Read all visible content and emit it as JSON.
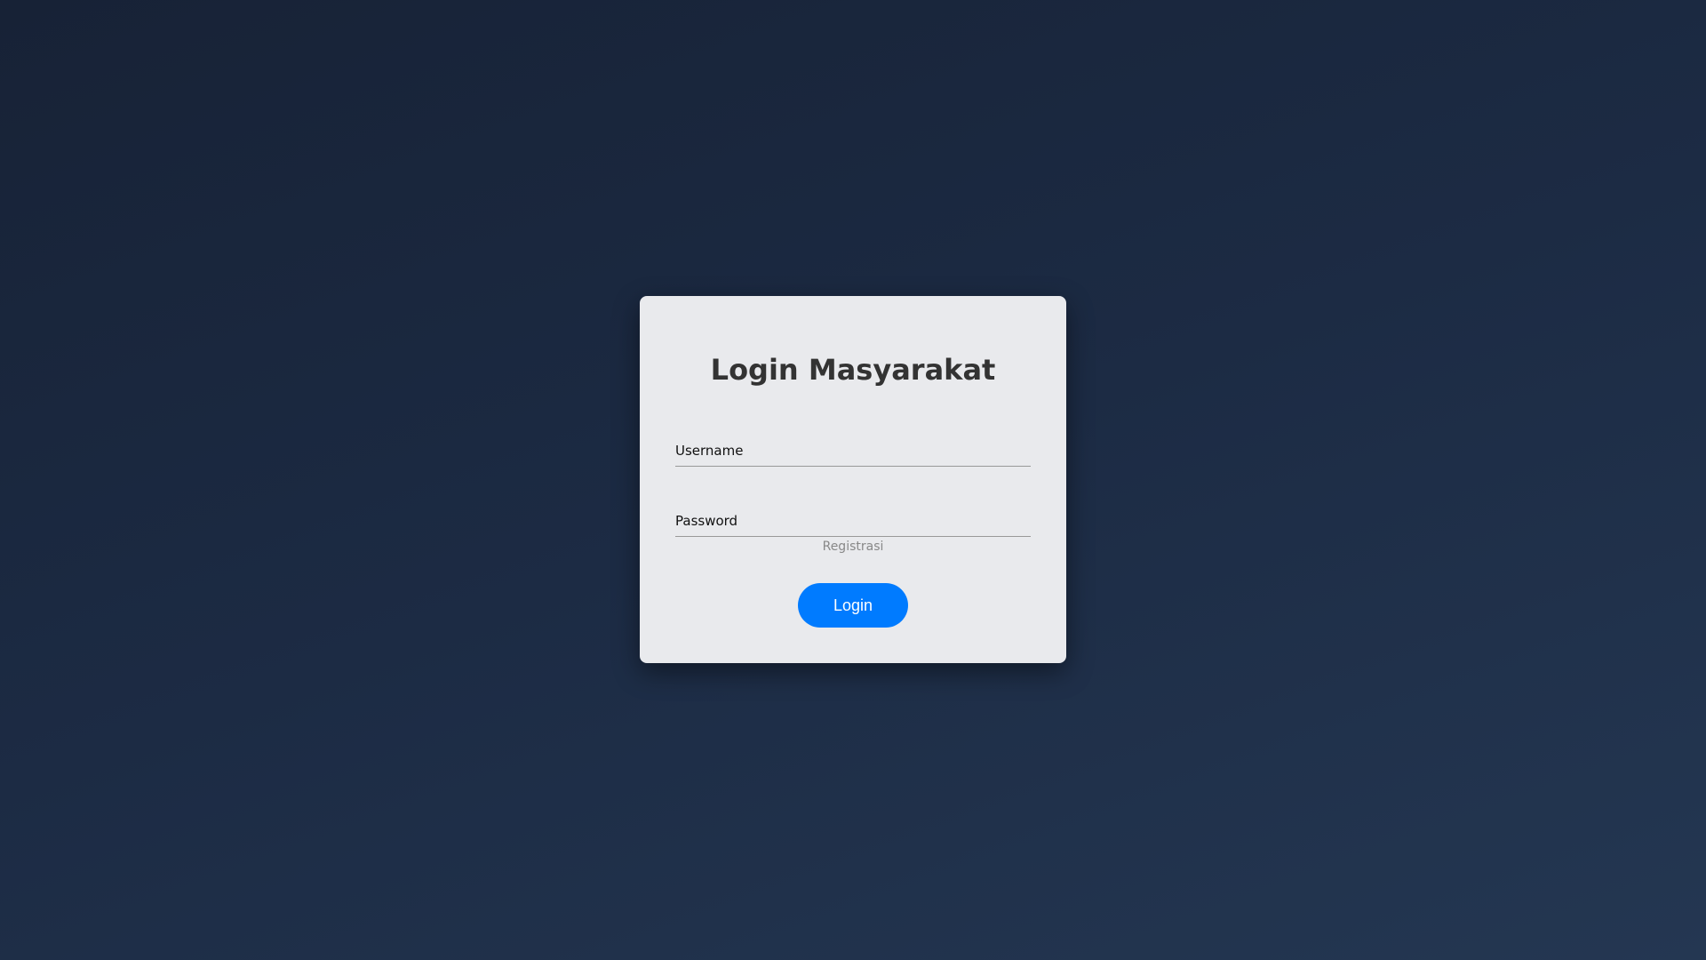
{
  "login_card": {
    "title": "Login Masyarakat",
    "username_placeholder": "Username",
    "password_placeholder": "Password",
    "register_link": "Registrasi",
    "login_button": "Login"
  },
  "colors": {
    "accent": "#007bff",
    "card": "#e9eaed",
    "background": "#1c2b44"
  }
}
